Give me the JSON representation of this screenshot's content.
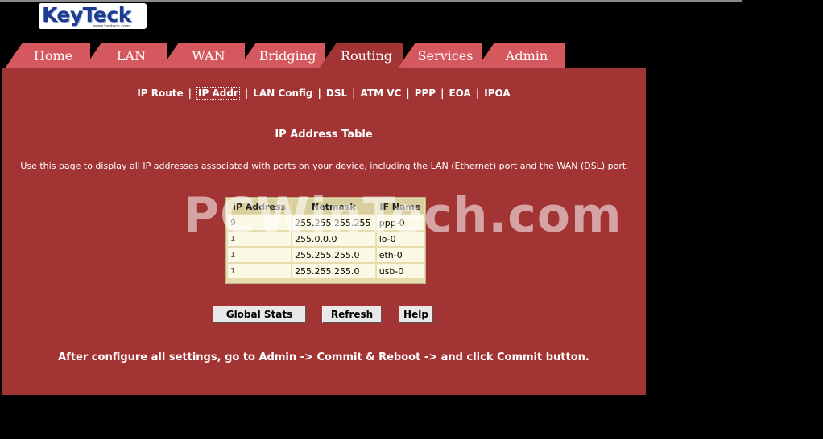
{
  "logo": {
    "text": "KeyTeck",
    "sub": "www.keyteck.com"
  },
  "tabs": [
    {
      "label": "Home"
    },
    {
      "label": "LAN"
    },
    {
      "label": "WAN"
    },
    {
      "label": "Bridging"
    },
    {
      "label": "Routing",
      "active": true
    },
    {
      "label": "Services"
    },
    {
      "label": "Admin"
    }
  ],
  "subnav": [
    {
      "label": "IP Route"
    },
    {
      "label": "IP Addr",
      "current": true
    },
    {
      "label": "LAN Config"
    },
    {
      "label": "DSL"
    },
    {
      "label": "ATM VC"
    },
    {
      "label": "PPP"
    },
    {
      "label": "EOA"
    },
    {
      "label": "IPOA"
    }
  ],
  "page": {
    "title": "IP Address Table",
    "description": "Use this page to display all IP addresses associated with ports on your device, including the LAN (Ethernet) port and the WAN (DSL) port."
  },
  "table": {
    "headers": [
      "IP Address",
      "Netmask",
      "IF Name"
    ],
    "rows": [
      {
        "ip": "9",
        "netmask": "255.255.255.255",
        "ifname": "ppp-0"
      },
      {
        "ip": "1",
        "netmask": "255.0.0.0",
        "ifname": "lo-0"
      },
      {
        "ip": "1",
        "netmask": "255.255.255.0",
        "ifname": "eth-0"
      },
      {
        "ip": "1",
        "netmask": "255.255.255.0",
        "ifname": "usb-0"
      }
    ]
  },
  "watermark": "PCWinTech.com",
  "buttons": {
    "global_stats": "Global Stats",
    "refresh": "Refresh",
    "help": "Help"
  },
  "note": "After configure all settings, go to Admin -> Commit & Reboot -> and click Commit button.",
  "colors": {
    "panel": "#a33434",
    "tab": "#d5585e",
    "table_bg": "#e6dcb0"
  }
}
